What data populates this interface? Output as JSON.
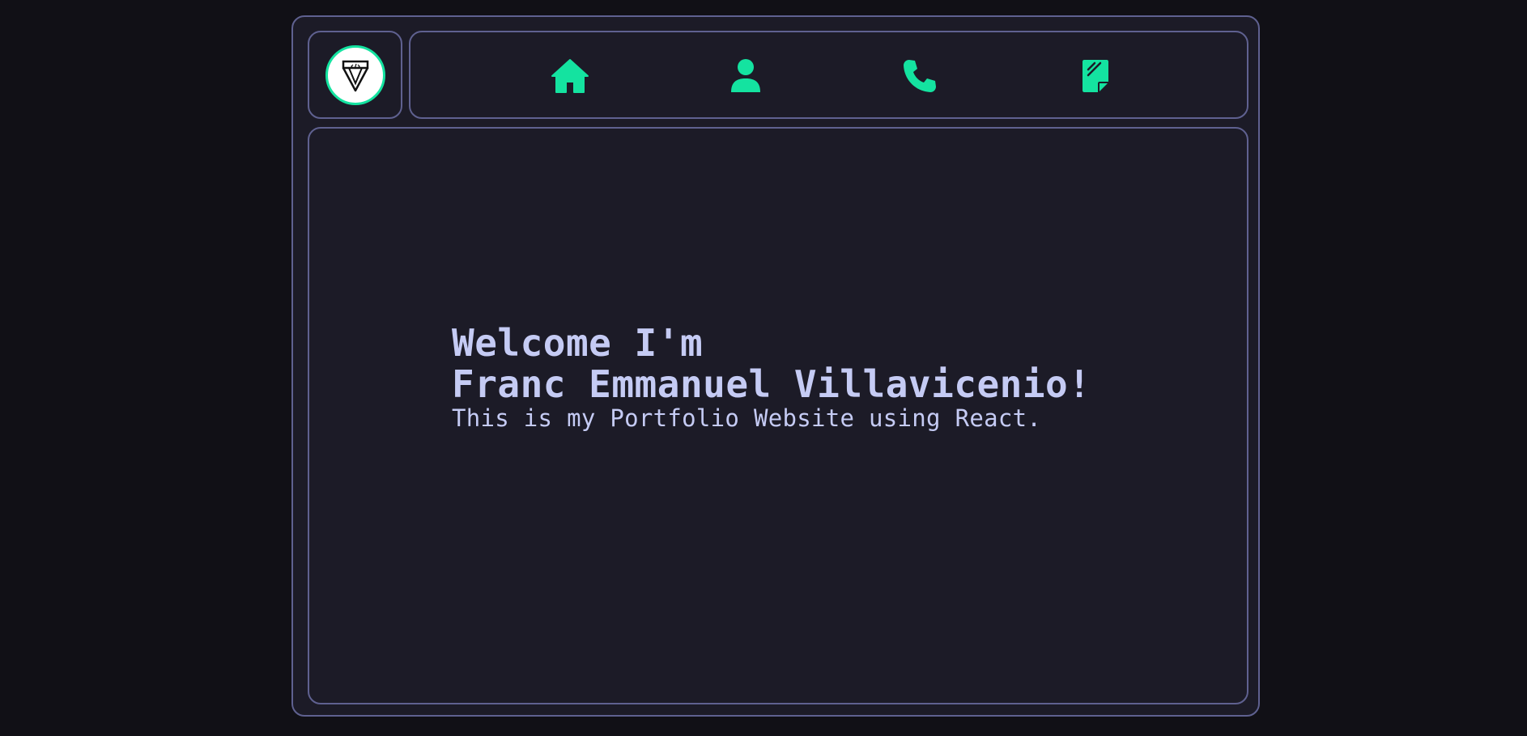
{
  "colors": {
    "accent": "#14e3a0",
    "border": "#5f6190",
    "panel": "#1c1b27",
    "background": "#111016",
    "text": "#c5cbf4"
  },
  "logo": {
    "icon": "pen-nib-logo-icon"
  },
  "nav": {
    "items": [
      {
        "icon": "home-icon"
      },
      {
        "icon": "user-icon"
      },
      {
        "icon": "phone-icon"
      },
      {
        "icon": "document-icon"
      }
    ]
  },
  "hero": {
    "line1": "Welcome I'm",
    "line2": "Franc Emmanuel Villavicenio!",
    "subtitle": "This is my Portfolio Website using React."
  }
}
